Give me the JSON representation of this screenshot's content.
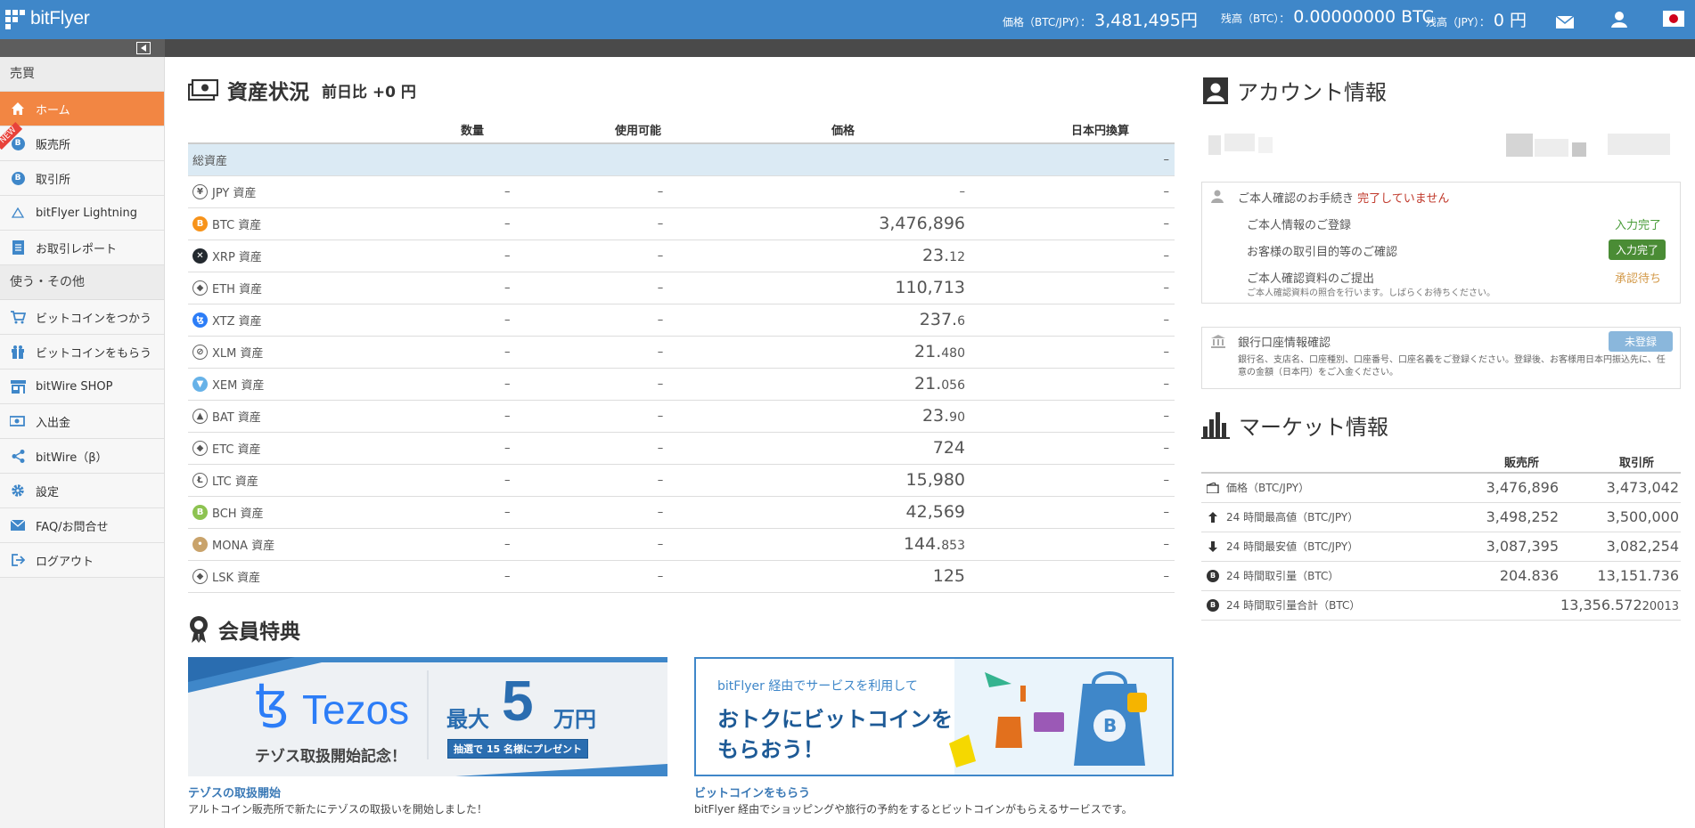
{
  "header": {
    "logo": "bitFlyer",
    "price_label": "価格（BTC/JPY）：",
    "price_value": "3,481,495円",
    "btc_label": "残高（BTC）：",
    "btc_value": "0.00000000 BTC",
    "jpy_label": "残高（JPY）：",
    "jpy_value": "0 円",
    "icons": [
      "mail-icon",
      "user-icon",
      "japan-flag-icon"
    ]
  },
  "sidebar": {
    "section1": "売買",
    "items1": [
      {
        "label": "ホーム",
        "icon": "home-icon",
        "active": true
      },
      {
        "label": "販売所",
        "icon": "bitcoin-icon",
        "badge": "NEW"
      },
      {
        "label": "取引所",
        "icon": "bitcoin-icon"
      },
      {
        "label": "bitFlyer Lightning",
        "icon": "lightning-icon"
      },
      {
        "label": "お取引レポート",
        "icon": "report-icon"
      }
    ],
    "section2": "使う・その他",
    "items2": [
      {
        "label": "ビットコインをつかう",
        "icon": "cart-icon"
      },
      {
        "label": "ビットコインをもらう",
        "icon": "gift-icon"
      },
      {
        "label": "bitWire SHOP",
        "icon": "shop-icon"
      },
      {
        "label": "入出金",
        "icon": "money-icon"
      },
      {
        "label": "bitWire（β）",
        "icon": "share-icon"
      },
      {
        "label": "設定",
        "icon": "gear-icon"
      },
      {
        "label": "FAQ/お問合せ",
        "icon": "mail-icon"
      },
      {
        "label": "ログアウト",
        "icon": "logout-icon"
      }
    ]
  },
  "assets": {
    "title": "資産状況",
    "subtitle": "前日比 +0 円",
    "columns": [
      "数量",
      "使用可能",
      "価格",
      "日本円換算"
    ],
    "total_label": "総資産",
    "total_value": "–",
    "rows": [
      {
        "name": "JPY 資産",
        "qty": "–",
        "avail": "–",
        "price_main": "–",
        "price_dec": "",
        "jpy": "–",
        "color": "#ffffff",
        "glyph": "¥"
      },
      {
        "name": "BTC 資産",
        "qty": "–",
        "avail": "–",
        "price_main": "3,476,896",
        "price_dec": "",
        "jpy": "–",
        "color": "#f7931a",
        "glyph": "B"
      },
      {
        "name": "XRP 資産",
        "qty": "–",
        "avail": "–",
        "price_main": "23.",
        "price_dec": "12",
        "jpy": "–",
        "color": "#23292f",
        "glyph": "✕"
      },
      {
        "name": "ETH 資産",
        "qty": "–",
        "avail": "–",
        "price_main": "110,713",
        "price_dec": "",
        "jpy": "–",
        "color": "#ffffff",
        "glyph": "◆"
      },
      {
        "name": "XTZ 資産",
        "qty": "–",
        "avail": "–",
        "price_main": "237.",
        "price_dec": "6",
        "jpy": "–",
        "color": "#2c7df7",
        "glyph": "ꜩ"
      },
      {
        "name": "XLM 資産",
        "qty": "–",
        "avail": "–",
        "price_main": "21.",
        "price_dec": "480",
        "jpy": "–",
        "color": "#ffffff",
        "glyph": "⊘"
      },
      {
        "name": "XEM 資産",
        "qty": "–",
        "avail": "–",
        "price_main": "21.",
        "price_dec": "056",
        "jpy": "–",
        "color": "#67b2e8",
        "glyph": "▼"
      },
      {
        "name": "BAT 資産",
        "qty": "–",
        "avail": "–",
        "price_main": "23.",
        "price_dec": "90",
        "jpy": "–",
        "color": "#ffffff",
        "glyph": "▲"
      },
      {
        "name": "ETC 資産",
        "qty": "–",
        "avail": "–",
        "price_main": "724",
        "price_dec": "",
        "jpy": "–",
        "color": "#ffffff",
        "glyph": "◆"
      },
      {
        "name": "LTC 資産",
        "qty": "–",
        "avail": "–",
        "price_main": "15,980",
        "price_dec": "",
        "jpy": "–",
        "color": "#ffffff",
        "glyph": "Ł"
      },
      {
        "name": "BCH 資産",
        "qty": "–",
        "avail": "–",
        "price_main": "42,569",
        "price_dec": "",
        "jpy": "–",
        "color": "#8dc351",
        "glyph": "B"
      },
      {
        "name": "MONA 資産",
        "qty": "–",
        "avail": "–",
        "price_main": "144.",
        "price_dec": "853",
        "jpy": "–",
        "color": "#c9a36b",
        "glyph": "•"
      },
      {
        "name": "LSK 資産",
        "qty": "–",
        "avail": "–",
        "price_main": "125",
        "price_dec": "",
        "jpy": "–",
        "color": "#ffffff",
        "glyph": "◆"
      }
    ]
  },
  "benefits": {
    "title": "会員特典",
    "banner1": {
      "brand": "Tezos",
      "caption": "テゾス取扱開始記念！",
      "headline": "最大",
      "amount": "5",
      "unit": "万円",
      "note": "抽選で 15 名様にプレゼント"
    },
    "banner2": {
      "line1": "bitFlyer 経由でサービスを利用して",
      "line2": "おトクにビットコインを",
      "line3": "もらおう！"
    },
    "link1": "テゾスの取扱開始",
    "desc1": "アルトコイン販売所で新たにテゾスの取扱いを開始しました！",
    "link2": "ビットコインをもらう",
    "desc2": "bitFlyer 経由でショッピングや旅行の予約をするとビットコインがもらえるサービスです。"
  },
  "account": {
    "title": "アカウント情報",
    "verify_label": "ご本人確認のお手続き",
    "verify_status": "完了していません",
    "steps": [
      {
        "label": "ご本人情報のご登録",
        "status": "入力完了",
        "style": "text-green"
      },
      {
        "label": "お客様の取引目的等のご確認",
        "status": "入力完了",
        "style": "pill-green"
      },
      {
        "label": "ご本人確認資料のご提出",
        "status": "承認待ち",
        "style": "text-orange"
      }
    ],
    "step3_note": "ご本人確認資料の照合を行います。しばらくお待ちください。",
    "bank_label": "銀行口座情報確認",
    "bank_status": "未登録",
    "bank_note": "銀行名、支店名、口座種別、口座番号、口座名義をご登録ください。登録後、お客様用日本円振込先に、任意の金額（日本円）をご入金ください。"
  },
  "market": {
    "title": "マーケット情報",
    "columns": [
      "販売所",
      "取引所"
    ],
    "rows": [
      {
        "icon": "wallet-icon",
        "label": "価格（BTC/JPY）",
        "shop": "3,476,896",
        "shop_dec": "",
        "ex": "3,473,042",
        "ex_dec": ""
      },
      {
        "icon": "arrow-up-icon",
        "label": "24 時間最高値（BTC/JPY）",
        "shop": "3,498,252",
        "shop_dec": "",
        "ex": "3,500,000",
        "ex_dec": ""
      },
      {
        "icon": "arrow-down-icon",
        "label": "24 時間最安値（BTC/JPY）",
        "shop": "3,087,395",
        "shop_dec": "",
        "ex": "3,082,254",
        "ex_dec": ""
      },
      {
        "icon": "bitcoin-icon",
        "label": "24 時間取引量（BTC）",
        "shop": "204.836",
        "shop_dec": "",
        "ex": "13,151.736",
        "ex_dec": ""
      },
      {
        "icon": "bitcoin-icon",
        "label": "24 時間取引量合計（BTC）",
        "shop": "",
        "shop_dec": "",
        "ex": "13,356.572",
        "ex_dec": "20013"
      }
    ]
  }
}
